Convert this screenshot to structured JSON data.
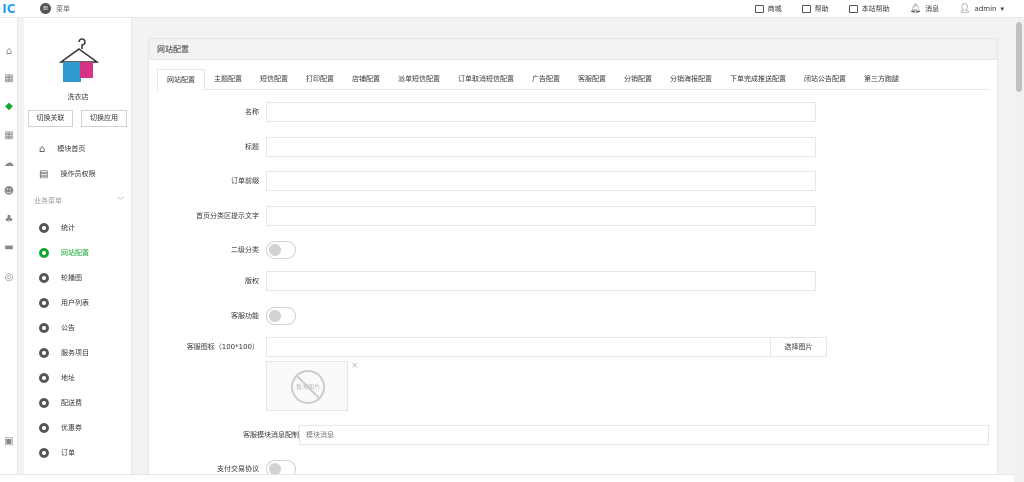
{
  "topbar": {
    "logo": "IC",
    "menu_label": "菜单",
    "nav": [
      {
        "label": "商城",
        "icon": "shop-icon"
      },
      {
        "label": "帮助",
        "icon": "help-icon"
      },
      {
        "label": "本站帮助",
        "icon": "site-help-icon"
      },
      {
        "label": "消息",
        "icon": "bell-icon"
      },
      {
        "label": "admin",
        "icon": "user-icon"
      }
    ]
  },
  "sidebar": {
    "shop_name": "洗衣店",
    "switch_link_button": "切换关联",
    "switch_app_button": "切换应用",
    "top_items": [
      {
        "label": "模块首页"
      },
      {
        "label": "操作员权限"
      }
    ],
    "section_title": "业务菜单",
    "items": [
      {
        "label": "统计"
      },
      {
        "label": "网站配置"
      },
      {
        "label": "轮播图"
      },
      {
        "label": "用户列表"
      },
      {
        "label": "公告"
      },
      {
        "label": "服务项目"
      },
      {
        "label": "地址"
      },
      {
        "label": "配送费"
      },
      {
        "label": "优惠券"
      },
      {
        "label": "订单"
      }
    ]
  },
  "main": {
    "panel_title": "网站配置",
    "tabs": [
      "网站配置",
      "主题配置",
      "短信配置",
      "打印配置",
      "店铺配置",
      "派单短信配置",
      "订单取消短信配置",
      "广告配置",
      "客服配置",
      "分销配置",
      "分销海报配置",
      "下单完成推送配置",
      "闭站公告配置",
      "第三方跑腿"
    ],
    "active_tab": "网站配置",
    "fields": {
      "name_label": "名称",
      "title_label": "标题",
      "order_prefix_label": "订单前缀",
      "home_cat_label": "首页分类区提示文字",
      "sub_cat_label": "二级分类",
      "copyright_label": "版权",
      "service_label": "客服功能",
      "service_icon_label": "客服图标（100*100）",
      "select_image_button": "选择图片",
      "no_image_text": "暂无图片",
      "service_msg_label": "客服模块消息配制",
      "service_msg_placeholder": "模块消息",
      "pay_agreement_label": "支付交易协议"
    }
  }
}
